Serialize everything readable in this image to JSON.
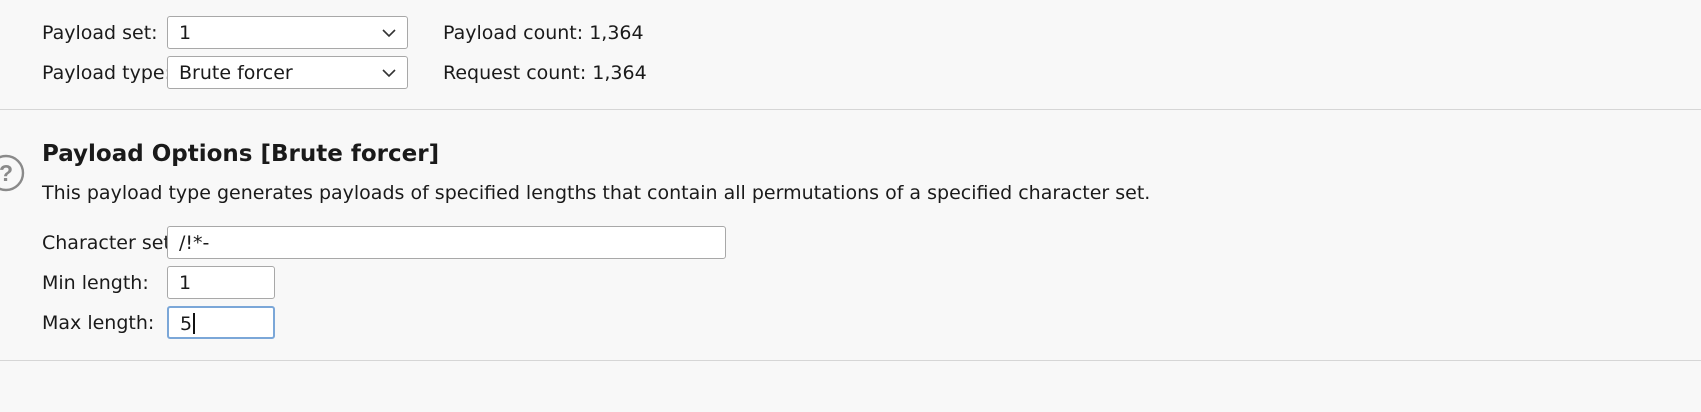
{
  "payload_sets": {
    "set_label": "Payload set:",
    "set_value": "1",
    "type_label": "Payload type:",
    "type_value": "Brute forcer",
    "payload_count_label": "Payload count:",
    "payload_count_value": "1,364",
    "request_count_label": "Request count:",
    "request_count_value": "1,364"
  },
  "options": {
    "help_icon": "question-circle-icon",
    "title": "Payload Options [Brute forcer]",
    "description": "This payload type generates payloads of specified lengths that contain all permutations of a specified character set.",
    "charset_label": "Character set:",
    "charset_value": "/!*-",
    "min_label": "Min length:",
    "min_value": "1",
    "max_label": "Max length:",
    "max_value": "5"
  },
  "colors": {
    "focus_border": "#7ba7d8",
    "input_border": "#a8a8a8",
    "help_icon": "#8a8a8a"
  }
}
